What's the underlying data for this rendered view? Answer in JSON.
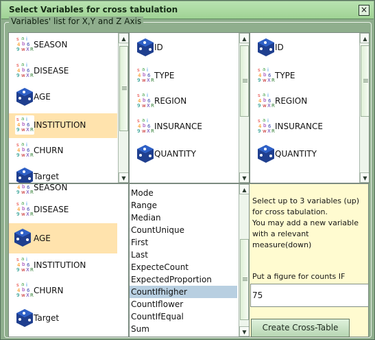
{
  "window": {
    "title": "Select Variables for cross tabulation"
  },
  "groupTitle": "Variables' list for X,Y and Z Axis",
  "pane1": {
    "items": [
      "SEASON",
      "DISEASE",
      "AGE",
      "INSTITUTION",
      "CHURN",
      "Target"
    ]
  },
  "pane2": {
    "items": [
      "ID",
      "TYPE",
      "REGION",
      "INSURANCE",
      "QUANTITY"
    ]
  },
  "pane3": {
    "items": [
      "ID",
      "TYPE",
      "REGION",
      "INSURANCE",
      "QUANTITY"
    ]
  },
  "pane4": {
    "items": [
      "SEASON",
      "DISEASE",
      "AGE",
      "INSTITUTION",
      "CHURN",
      "Target"
    ]
  },
  "functions": [
    "Mode",
    "Range",
    "Median",
    "CountUnique",
    "First",
    "Last",
    "ExpecteCount",
    "ExpectedProportion",
    "CountIfhigher",
    "CountIflower",
    "CountIfEqual",
    "Sum"
  ],
  "info": {
    "line1": "Select up to 3 variables (up)",
    "line2": "for cross tabulation.",
    "line3": "You may add a new variable",
    "line4": "with a relevant",
    "line5": "measure(down)",
    "countLabel": "Put a figure for counts IF",
    "countValue": "75",
    "buttonLabel": "Create Cross-Table"
  },
  "colors": {
    "selectedItem": "#ffe3ad",
    "selectedFunction": "#b8cfe1",
    "infoPanel": "#fffbd0"
  },
  "icons": {
    "variable": "mixed-data-icon",
    "identifier": "dice-icon"
  }
}
